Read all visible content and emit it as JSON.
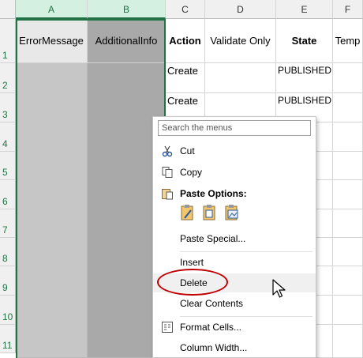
{
  "columns": [
    {
      "letter": "A"
    },
    {
      "letter": "B"
    },
    {
      "letter": "C"
    },
    {
      "letter": "D"
    },
    {
      "letter": "E"
    },
    {
      "letter": "F"
    }
  ],
  "rows": [
    "1",
    "2",
    "3",
    "4",
    "5",
    "6",
    "7",
    "8",
    "9",
    "10",
    "11"
  ],
  "header_cells": {
    "a1": "ErrorMessage",
    "b1": "AdditionalInfo",
    "c1": "Action",
    "d1": "Validate Only",
    "e1": "State",
    "f1": "Temp"
  },
  "data_cells": {
    "c2": "Create",
    "e2": "PUBLISHED",
    "c3": "Create",
    "e3": "PUBLISHED"
  },
  "context_menu": {
    "search_placeholder": "Search the menus",
    "cut": "Cut",
    "copy": "Copy",
    "paste_options": "Paste Options:",
    "paste_special": "Paste Special...",
    "insert": "Insert",
    "delete": "Delete",
    "clear_contents": "Clear Contents",
    "format_cells": "Format Cells...",
    "column_width": "Column Width..."
  },
  "colors": {
    "accent": "#217346",
    "highlight_circle": "#c00000",
    "selected_fill": "#c6c6c6"
  }
}
